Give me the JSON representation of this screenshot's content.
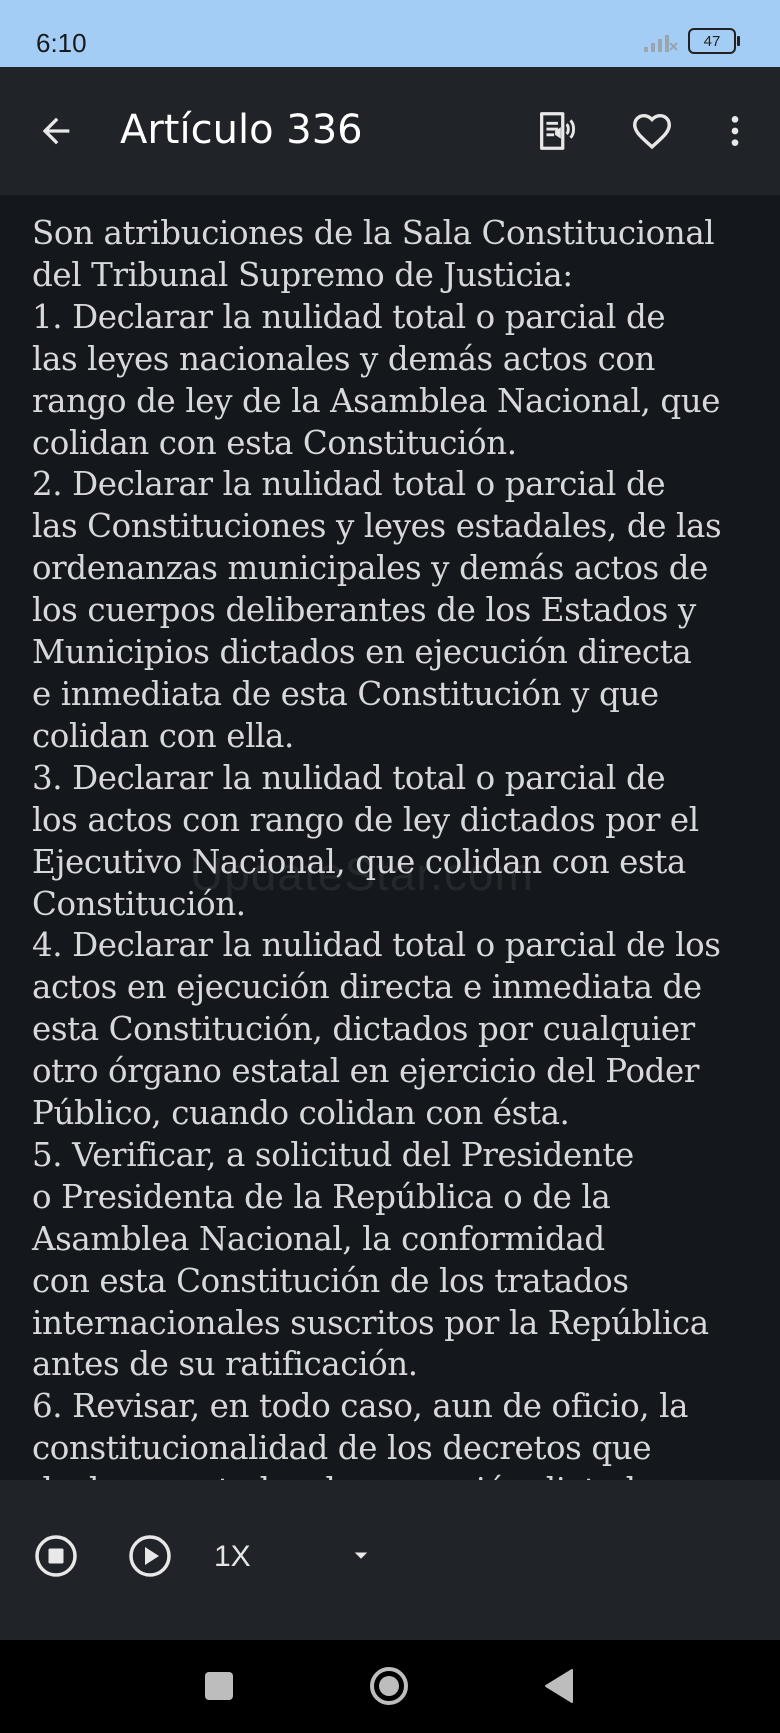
{
  "status_bar": {
    "time": "6:10",
    "battery": "47"
  },
  "app_bar": {
    "title": "Artículo 336"
  },
  "article": {
    "text": "Son atribuciones de la Sala Constitucional\ndel Tribunal Supremo de Justicia:\n1. Declarar la nulidad total o parcial de\nlas leyes nacionales y demás actos con\nrango de ley de la Asamblea Nacional, que\ncolidan con esta Constitución.\n2. Declarar la nulidad total o parcial de\nlas Constituciones y leyes estadales, de las\nordenanzas municipales y demás actos de\nlos cuerpos deliberantes de los Estados y\nMunicipios dictados en ejecución directa\ne inmediata de esta Constitución y que\ncolidan con ella.\n3. Declarar la nulidad total o parcial de\nlos actos con rango de ley dictados por el\nEjecutivo Nacional, que colidan con esta\nConstitución.\n4. Declarar la nulidad total o parcial de los\nactos en ejecución directa e inmediata de\nesta Constitución, dictados por cualquier\notro órgano estatal en ejercicio del Poder\nPúblico, cuando colidan con ésta.\n5. Verificar, a solicitud del Presidente\no Presidenta de la República o de la\nAsamblea Nacional, la conformidad\ncon esta Constitución de los tratados\ninternacionales suscritos por la República\nantes de su ratificación.\n6. Revisar, en todo caso, aun de oficio, la\nconstitucionalidad de los decretos que\ndeclaren estados de excepción dictados"
  },
  "watermark": "UpdateStar.com",
  "player": {
    "speed": "1X"
  },
  "icons": {
    "back": "arrow-back-icon",
    "tts": "text-to-speech-icon",
    "favorite": "heart-outline-icon",
    "more": "more-vert-icon",
    "stop": "stop-circle-icon",
    "play": "play-circle-icon",
    "dropdown": "arrow-drop-down-icon"
  },
  "colors": {
    "status_bar": "#a3cdf5",
    "app_bar": "#202327",
    "background": "#14171b",
    "text": "#d7d8da"
  }
}
